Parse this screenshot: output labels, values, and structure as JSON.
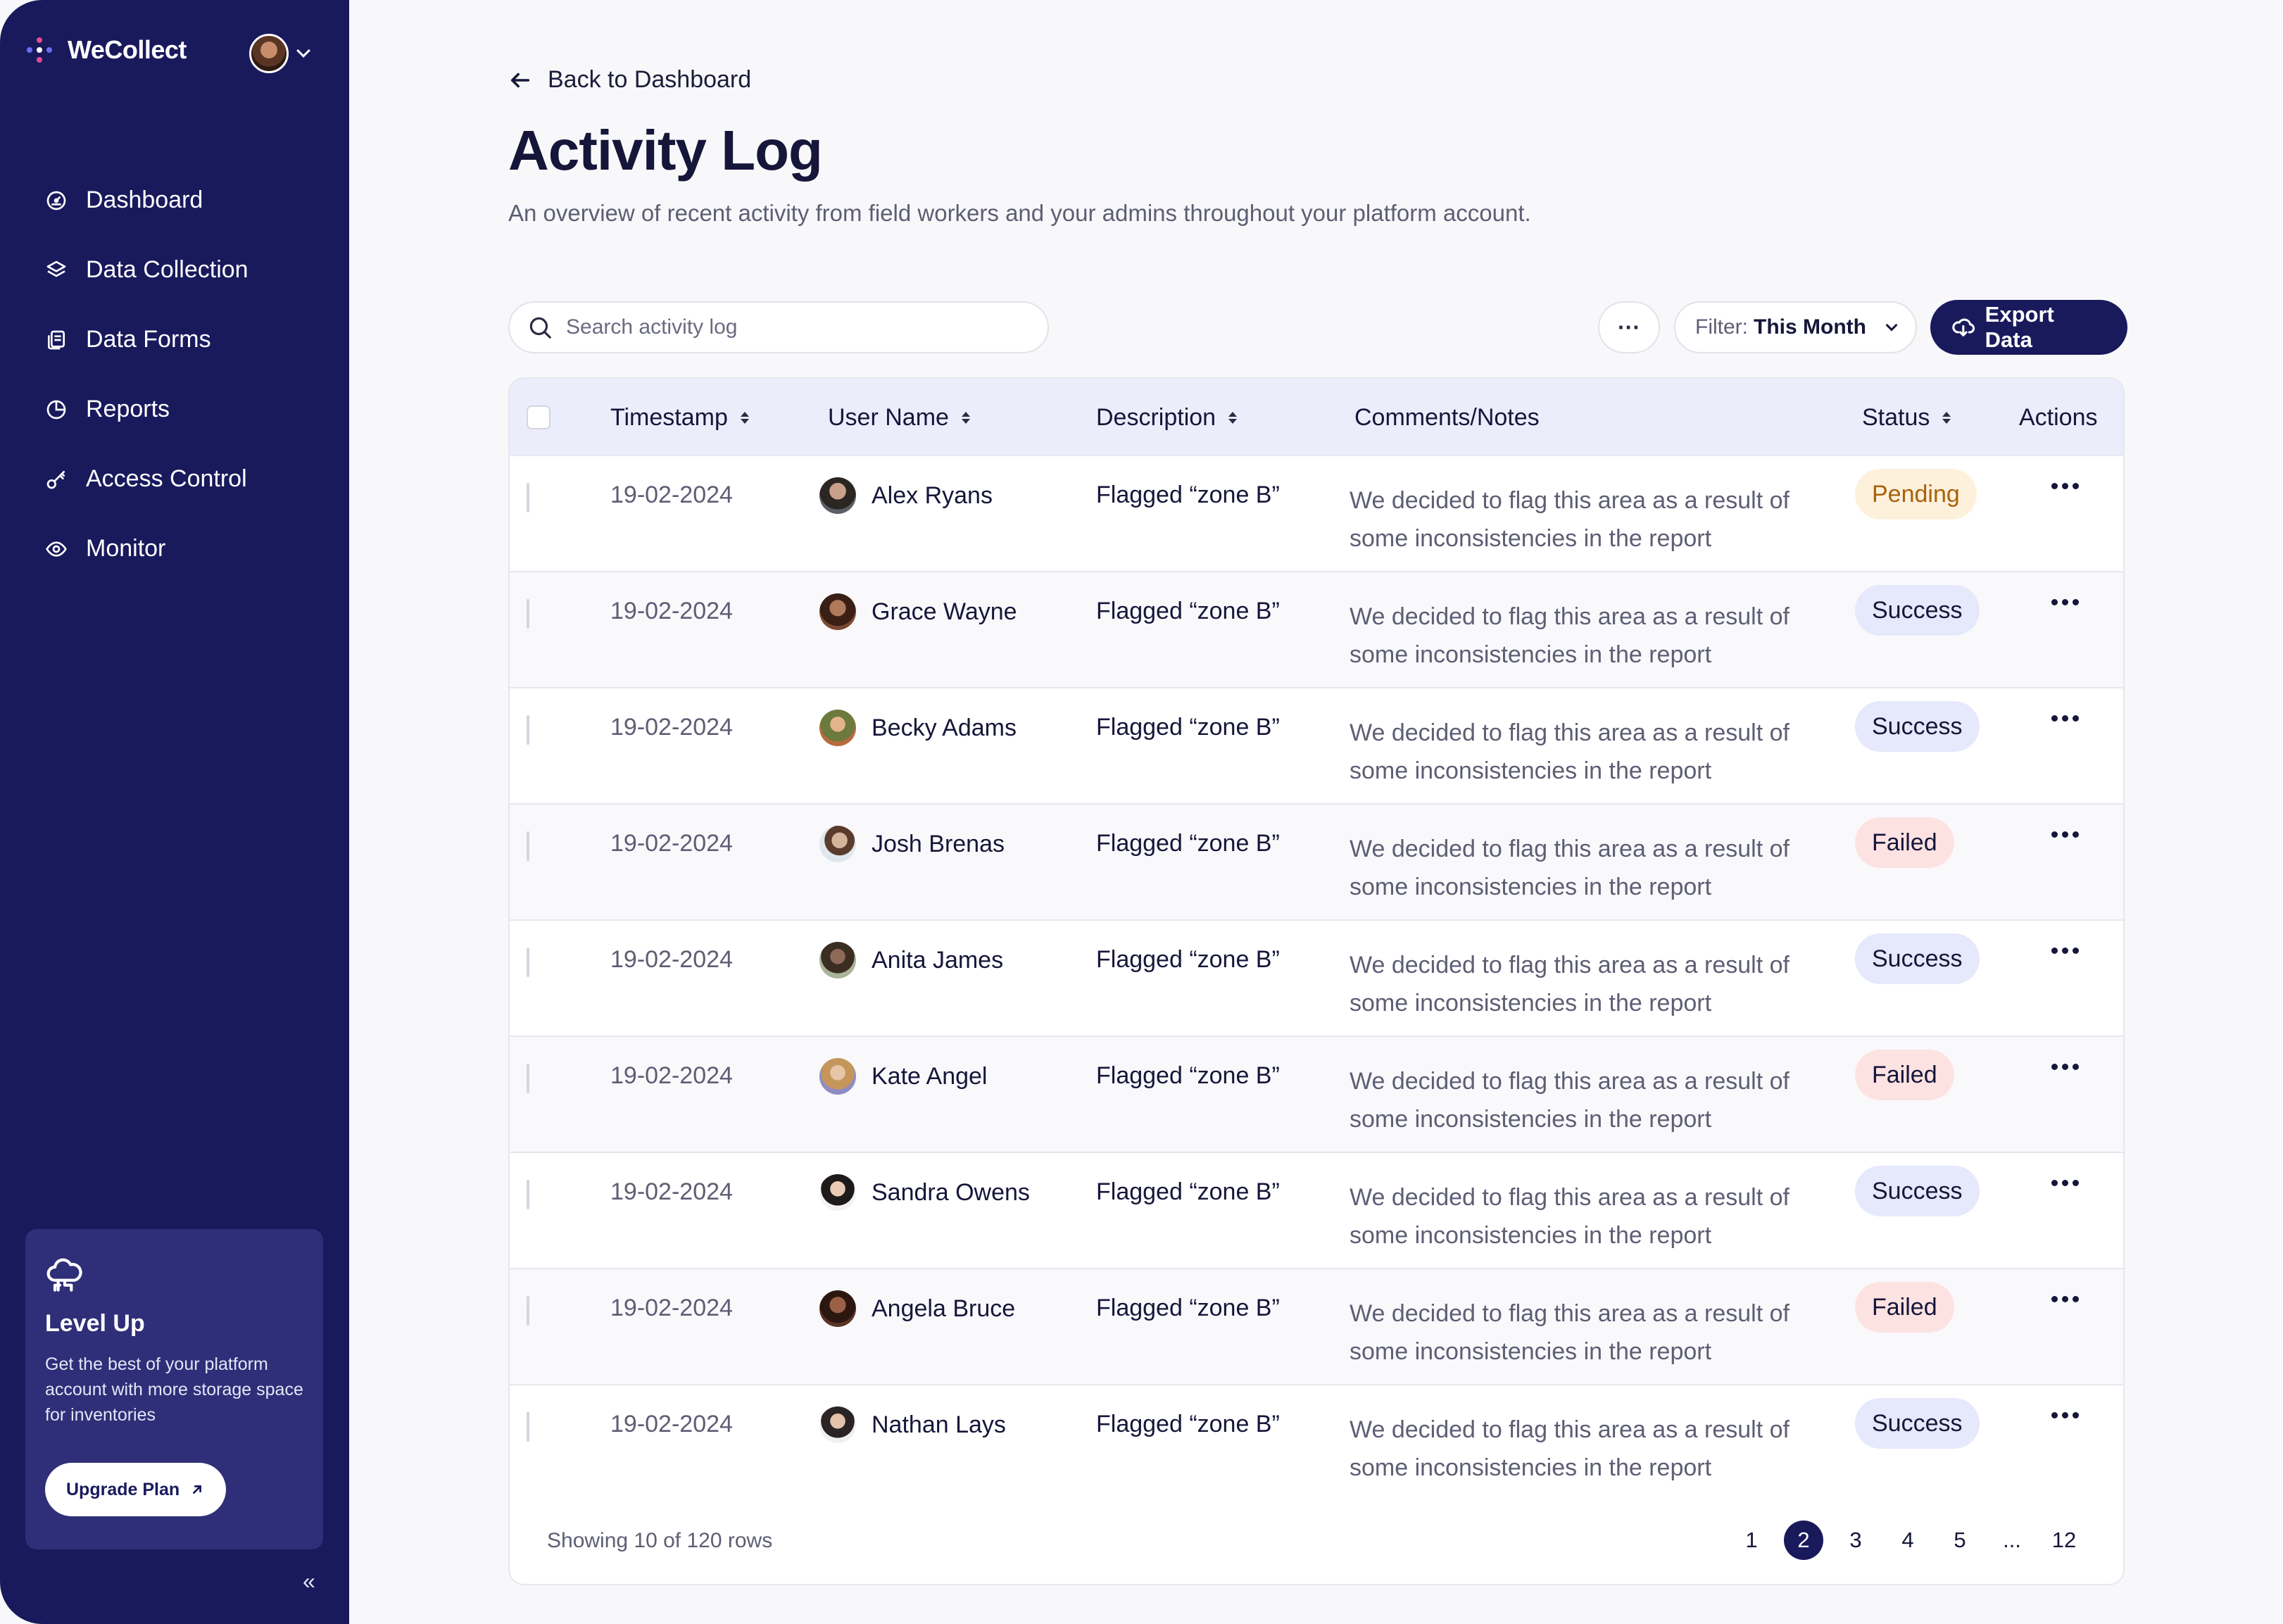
{
  "brand": {
    "name": "WeCollect"
  },
  "sidebar": {
    "items": [
      {
        "label": "Dashboard",
        "icon": "dashboard-icon"
      },
      {
        "label": "Data Collection",
        "icon": "layers-icon"
      },
      {
        "label": "Data Forms",
        "icon": "forms-icon"
      },
      {
        "label": "Reports",
        "icon": "pie-chart-icon"
      },
      {
        "label": "Access Control",
        "icon": "key-icon"
      },
      {
        "label": "Monitor",
        "icon": "eye-icon"
      }
    ],
    "upgrade": {
      "title": "Level Up",
      "text": "Get the best of your platform account with more storage space for inventories",
      "button": "Upgrade Plan"
    },
    "collapse": "«"
  },
  "header": {
    "back": "Back to Dashboard",
    "title": "Activity Log",
    "subtitle": "An overview of recent activity from field workers and your admins throughout your platform account."
  },
  "toolbar": {
    "search_placeholder": "Search activity log",
    "more": "···",
    "filter_label": "Filter:",
    "filter_value": "This Month",
    "export": "Export Data"
  },
  "table": {
    "columns": {
      "timestamp": "Timestamp",
      "user": "User Name",
      "description": "Description",
      "notes": "Comments/Notes",
      "status": "Status",
      "actions": "Actions"
    },
    "rows": [
      {
        "timestamp": "19-02-2024",
        "user": "Alex Ryans",
        "description": "Flagged “zone B”",
        "notes": "We decided to flag this area as a result of some inconsistencies in the report",
        "status": "Pending"
      },
      {
        "timestamp": "19-02-2024",
        "user": "Grace Wayne",
        "description": "Flagged “zone B”",
        "notes": "We decided to flag this area as a result of some inconsistencies in the report",
        "status": "Success"
      },
      {
        "timestamp": "19-02-2024",
        "user": "Becky Adams",
        "description": "Flagged “zone B”",
        "notes": "We decided to flag this area as a result of some inconsistencies in the report",
        "status": "Success"
      },
      {
        "timestamp": "19-02-2024",
        "user": "Josh Brenas",
        "description": "Flagged “zone B”",
        "notes": "We decided to flag this area as a result of some inconsistencies in the report",
        "status": "Failed"
      },
      {
        "timestamp": "19-02-2024",
        "user": "Anita James",
        "description": "Flagged “zone B”",
        "notes": "We decided to flag this area as a result of some inconsistencies in the report",
        "status": "Success"
      },
      {
        "timestamp": "19-02-2024",
        "user": "Kate Angel",
        "description": "Flagged “zone B”",
        "notes": "We decided to flag this area as a result of some inconsistencies in the report",
        "status": "Failed"
      },
      {
        "timestamp": "19-02-2024",
        "user": "Sandra Owens",
        "description": "Flagged “zone B”",
        "notes": "We decided to flag this area as a result of some inconsistencies in the report",
        "status": "Success"
      },
      {
        "timestamp": "19-02-2024",
        "user": "Angela Bruce",
        "description": "Flagged “zone B”",
        "notes": "We decided to flag this area as a result of some inconsistencies in the report",
        "status": "Failed"
      },
      {
        "timestamp": "19-02-2024",
        "user": "Nathan Lays",
        "description": "Flagged “zone B”",
        "notes": "We decided to flag this area as a result of some inconsistencies in the report",
        "status": "Success"
      }
    ],
    "footer": {
      "showing": "Showing 10 of 120 rows",
      "pages": [
        "1",
        "2",
        "3",
        "4",
        "5",
        "...",
        "12"
      ],
      "active_page": "2"
    }
  },
  "colors": {
    "sidebar_bg": "#191a5c",
    "accent": "#191a5c",
    "status_pending_bg": "#fdf1dc",
    "status_pending_fg": "#a8620a",
    "status_success_bg": "#e6e8fb",
    "status_success_fg": "#16163a",
    "status_failed_bg": "#fde2e2",
    "status_failed_fg": "#16163a"
  }
}
